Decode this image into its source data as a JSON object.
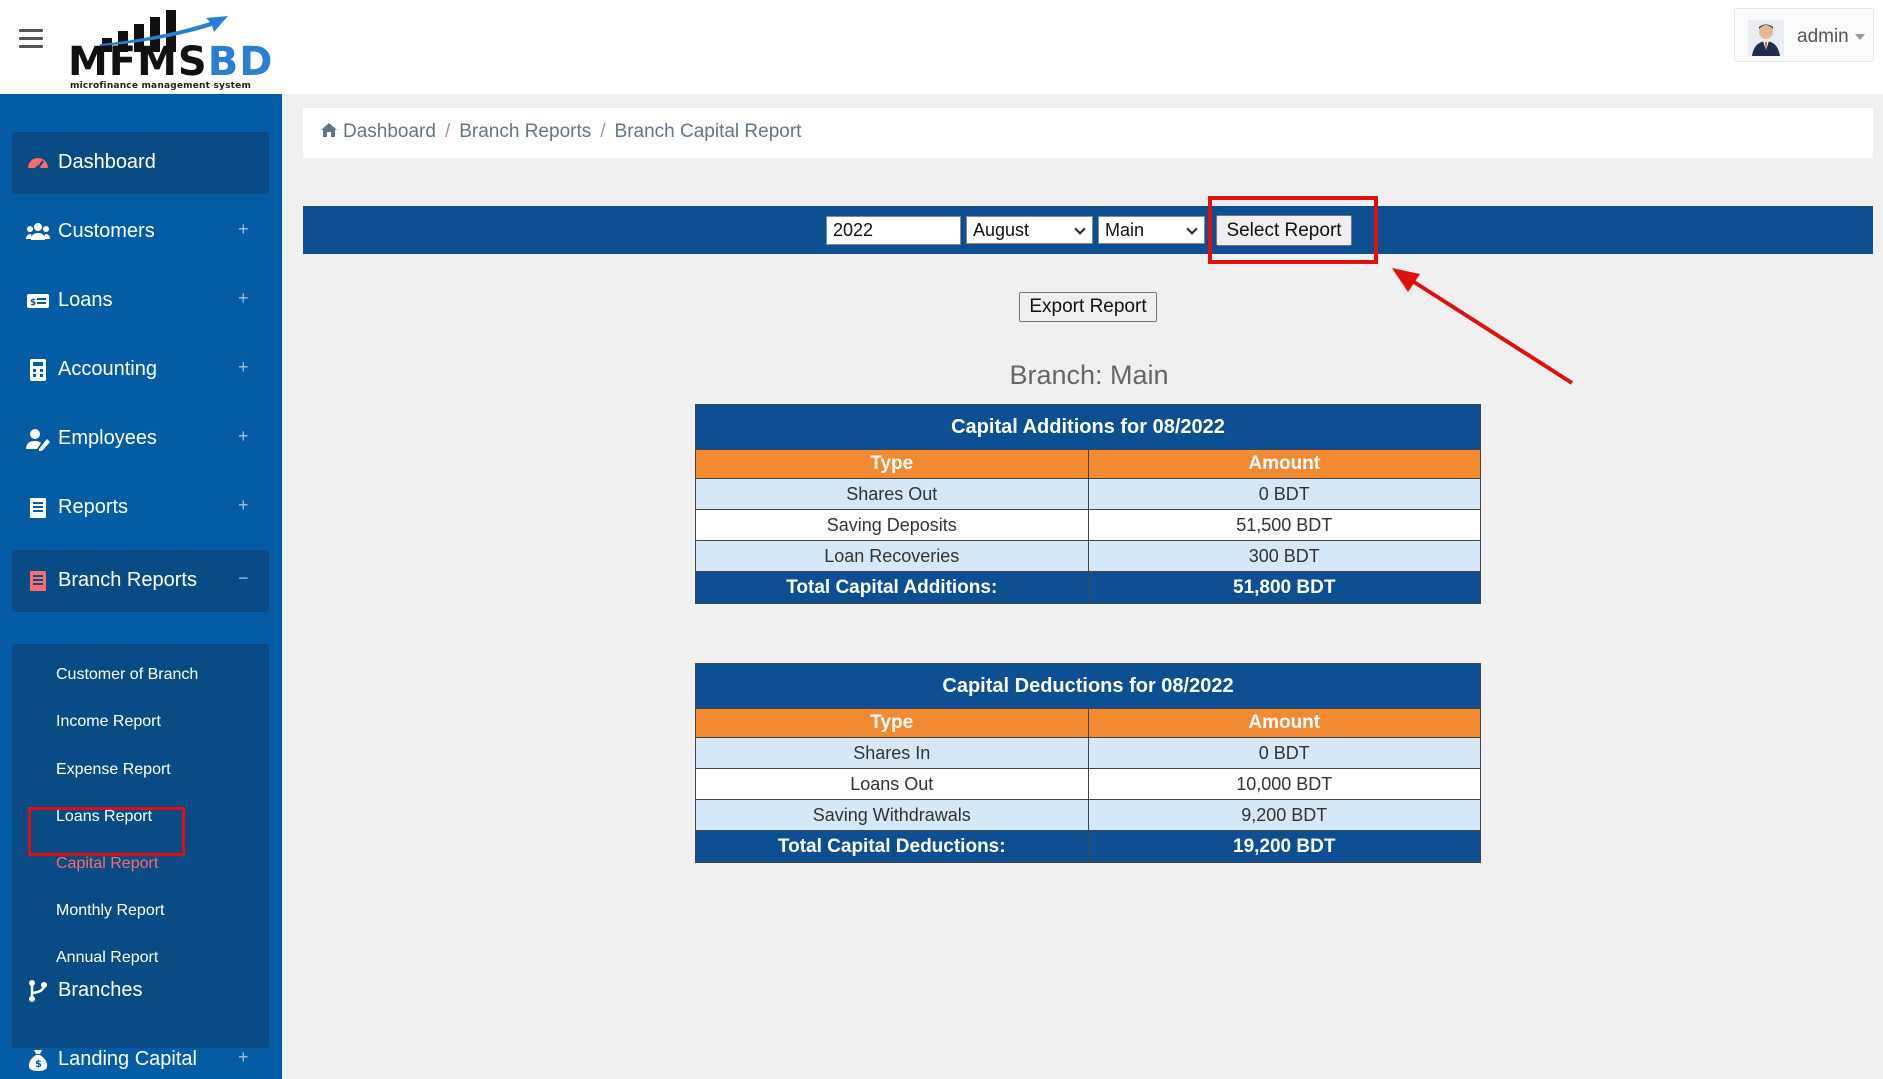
{
  "header": {
    "logo_text_main": "MFMS",
    "logo_text_accent": "BD",
    "logo_tagline": "microfinance management system",
    "user_name": "admin"
  },
  "sidebar": {
    "items": [
      {
        "label": "Dashboard",
        "icon": "dashboard-icon",
        "expand": ""
      },
      {
        "label": "Customers",
        "icon": "users-icon",
        "expand": "+"
      },
      {
        "label": "Loans",
        "icon": "money-card-icon",
        "expand": "+"
      },
      {
        "label": "Accounting",
        "icon": "calculator-icon",
        "expand": "+"
      },
      {
        "label": "Employees",
        "icon": "user-edit-icon",
        "expand": "+"
      },
      {
        "label": "Reports",
        "icon": "report-icon",
        "expand": "+"
      },
      {
        "label": "Branch Reports",
        "icon": "report-icon",
        "expand": "−"
      },
      {
        "label": "Branches",
        "icon": "branch-icon",
        "expand": ""
      },
      {
        "label": "Landing Capital",
        "icon": "money-bag-icon",
        "expand": "+"
      }
    ],
    "branch_reports_sub": [
      "Customer of Branch",
      "Income Report",
      "Expense Report",
      "Loans Report",
      "Capital Report",
      "Monthly Report",
      "Annual Report"
    ]
  },
  "breadcrumb": {
    "items": [
      "Dashboard",
      "Branch Reports",
      "Branch Capital Report"
    ],
    "separator": "/"
  },
  "filter": {
    "year_value": "2022",
    "month_value": "August",
    "branch_value": "Main",
    "select_label": "Select Report"
  },
  "export_label": "Export Report",
  "branch_title": "Branch: Main",
  "additions": {
    "title": "Capital Additions for 08/2022",
    "headers": [
      "Type",
      "Amount"
    ],
    "rows": [
      [
        "Shares Out",
        "0 BDT"
      ],
      [
        "Saving Deposits",
        "51,500 BDT"
      ],
      [
        "Loan Recoveries",
        "300 BDT"
      ]
    ],
    "total": [
      "Total Capital Additions:",
      "51,800 BDT"
    ]
  },
  "deductions": {
    "title": "Capital Deductions for 08/2022",
    "headers": [
      "Type",
      "Amount"
    ],
    "rows": [
      [
        "Shares In",
        "0 BDT"
      ],
      [
        "Loans Out",
        "10,000 BDT"
      ],
      [
        "Saving Withdrawals",
        "9,200 BDT"
      ]
    ],
    "total": [
      "Total Capital Deductions:",
      "19,200 BDT"
    ]
  },
  "colors": {
    "sidebar_bg": "#045ca5",
    "sidebar_active": "#084b85",
    "table_header": "#0c4f93",
    "table_subheader": "#f38a32",
    "row_alt": "#d5e8f8",
    "highlight": "#e01010",
    "active_sub": "#ff6b6b"
  }
}
